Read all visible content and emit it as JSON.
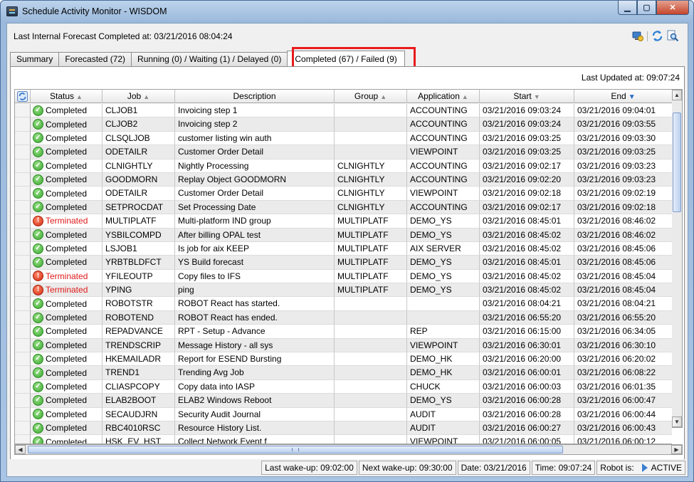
{
  "window": {
    "title": "Schedule Activity Monitor - WISDOM"
  },
  "header": {
    "forecast_text": "Last Internal Forecast Completed at:  03/21/2016 08:04:24"
  },
  "tabs": [
    {
      "label": "Summary"
    },
    {
      "label": "Forecasted (72)"
    },
    {
      "label": "Running (0) / Waiting (1) / Delayed (0)"
    },
    {
      "label": "Completed (67) / Failed (9)"
    }
  ],
  "panel": {
    "last_updated": "Last Updated at: 09:07:24"
  },
  "columns": {
    "status": "Status",
    "job": "Job",
    "description": "Description",
    "group": "Group",
    "application": "Application",
    "start": "Start",
    "end": "End"
  },
  "rows": [
    {
      "status": "Completed",
      "job": "CLJOB1",
      "description": "Invoicing step 1",
      "group": "",
      "application": "ACCOUNTING",
      "start": "03/21/2016 09:03:24",
      "end": "03/21/2016 09:04:01"
    },
    {
      "status": "Completed",
      "job": "CLJOB2",
      "description": "Invoicing step 2",
      "group": "",
      "application": "ACCOUNTING",
      "start": "03/21/2016 09:03:24",
      "end": "03/21/2016 09:03:55"
    },
    {
      "status": "Completed",
      "job": "CLSQLJOB",
      "description": "customer listing win auth",
      "group": "",
      "application": "ACCOUNTING",
      "start": "03/21/2016 09:03:25",
      "end": "03/21/2016 09:03:30"
    },
    {
      "status": "Completed",
      "job": "ODETAILR",
      "description": "Customer Order Detail",
      "group": "",
      "application": "VIEWPOINT",
      "start": "03/21/2016 09:03:25",
      "end": "03/21/2016 09:03:25"
    },
    {
      "status": "Completed",
      "job": "CLNIGHTLY",
      "description": "Nightly Processing",
      "group": "CLNIGHTLY",
      "application": "ACCOUNTING",
      "start": "03/21/2016 09:02:17",
      "end": "03/21/2016 09:03:23"
    },
    {
      "status": "Completed",
      "job": "GOODMORN",
      "description": "Replay Object GOODMORN",
      "group": "CLNIGHTLY",
      "application": "ACCOUNTING",
      "start": "03/21/2016 09:02:20",
      "end": "03/21/2016 09:03:23"
    },
    {
      "status": "Completed",
      "job": "ODETAILR",
      "description": "Customer Order Detail",
      "group": "CLNIGHTLY",
      "application": "VIEWPOINT",
      "start": "03/21/2016 09:02:18",
      "end": "03/21/2016 09:02:19"
    },
    {
      "status": "Completed",
      "job": "SETPROCDAT",
      "description": "Set Processing Date",
      "group": "CLNIGHTLY",
      "application": "ACCOUNTING",
      "start": "03/21/2016 09:02:17",
      "end": "03/21/2016 09:02:18"
    },
    {
      "status": "Terminated",
      "job": "MULTIPLATF",
      "description": "Multi-platform IND group",
      "group": "MULTIPLATF",
      "application": "DEMO_YS",
      "start": "03/21/2016 08:45:01",
      "end": "03/21/2016 08:46:02"
    },
    {
      "status": "Completed",
      "job": "YSBILCOMPD",
      "description": "After billing OPAL test",
      "group": "MULTIPLATF",
      "application": "DEMO_YS",
      "start": "03/21/2016 08:45:02",
      "end": "03/21/2016 08:46:02"
    },
    {
      "status": "Completed",
      "job": "LSJOB1",
      "description": "Is job for aix KEEP",
      "group": "MULTIPLATF",
      "application": "AIX SERVER",
      "start": "03/21/2016 08:45:02",
      "end": "03/21/2016 08:45:06"
    },
    {
      "status": "Completed",
      "job": "YRBTBLDFCT",
      "description": "YS Build forecast",
      "group": "MULTIPLATF",
      "application": "DEMO_YS",
      "start": "03/21/2016 08:45:01",
      "end": "03/21/2016 08:45:06"
    },
    {
      "status": "Terminated",
      "job": "YFILEOUTP",
      "description": "Copy files to IFS",
      "group": "MULTIPLATF",
      "application": "DEMO_YS",
      "start": "03/21/2016 08:45:02",
      "end": "03/21/2016 08:45:04"
    },
    {
      "status": "Terminated",
      "job": "YPING",
      "description": "ping",
      "group": "MULTIPLATF",
      "application": "DEMO_YS",
      "start": "03/21/2016 08:45:02",
      "end": "03/21/2016 08:45:04"
    },
    {
      "status": "Completed",
      "job": "ROBOTSTR",
      "description": "ROBOT React has started.",
      "group": "",
      "application": "",
      "start": "03/21/2016 08:04:21",
      "end": "03/21/2016 08:04:21"
    },
    {
      "status": "Completed",
      "job": "ROBOTEND",
      "description": "ROBOT React has ended.",
      "group": "",
      "application": "",
      "start": "03/21/2016 06:55:20",
      "end": "03/21/2016 06:55:20"
    },
    {
      "status": "Completed",
      "job": "REPADVANCE",
      "description": "RPT - Setup - Advance",
      "group": "",
      "application": "REP",
      "start": "03/21/2016 06:15:00",
      "end": "03/21/2016 06:34:05"
    },
    {
      "status": "Completed",
      "job": "TRENDSCRIP",
      "description": "Message History - all sys",
      "group": "",
      "application": "VIEWPOINT",
      "start": "03/21/2016 06:30:01",
      "end": "03/21/2016 06:30:10"
    },
    {
      "status": "Completed",
      "job": "HKEMAILADR",
      "description": "Report for ESEND Bursting",
      "group": "",
      "application": "DEMO_HK",
      "start": "03/21/2016 06:20:00",
      "end": "03/21/2016 06:20:02"
    },
    {
      "status": "Completed",
      "job": "TREND1",
      "description": "Trending Avg Job",
      "group": "",
      "application": "DEMO_HK",
      "start": "03/21/2016 06:00:01",
      "end": "03/21/2016 06:08:22"
    },
    {
      "status": "Completed",
      "job": "CLIASPCOPY",
      "description": "Copy data into IASP",
      "group": "",
      "application": "CHUCK",
      "start": "03/21/2016 06:00:03",
      "end": "03/21/2016 06:01:35"
    },
    {
      "status": "Completed",
      "job": "ELAB2BOOT",
      "description": "ELAB2 Windows Reboot",
      "group": "",
      "application": "DEMO_YS",
      "start": "03/21/2016 06:00:28",
      "end": "03/21/2016 06:00:47"
    },
    {
      "status": "Completed",
      "job": "SECAUDJRN",
      "description": "Security Audit Journal",
      "group": "",
      "application": "AUDIT",
      "start": "03/21/2016 06:00:28",
      "end": "03/21/2016 06:00:44"
    },
    {
      "status": "Completed",
      "job": "RBC4010RSC",
      "description": "Resource History List.",
      "group": "",
      "application": "AUDIT",
      "start": "03/21/2016 06:00:27",
      "end": "03/21/2016 06:00:43"
    },
    {
      "status": "Completed",
      "job": "HSK_EV_HST",
      "description": "Collect Network Event f",
      "group": "",
      "application": "VIEWPOINT",
      "start": "03/21/2016 06:00:05",
      "end": "03/21/2016 06:00:12"
    }
  ],
  "statusbar": {
    "last_wakeup": "Last wake-up: 09:02:00",
    "next_wakeup": "Next wake-up: 09:30:00",
    "date": "Date:  03/21/2016",
    "time": "Time:  09:07:24",
    "robot_label": "Robot is:",
    "robot_state": "ACTIVE"
  },
  "colors": {
    "terminated": "#e01a1a",
    "highlight": "#e81b1b",
    "sort_active": "#2469c9"
  }
}
